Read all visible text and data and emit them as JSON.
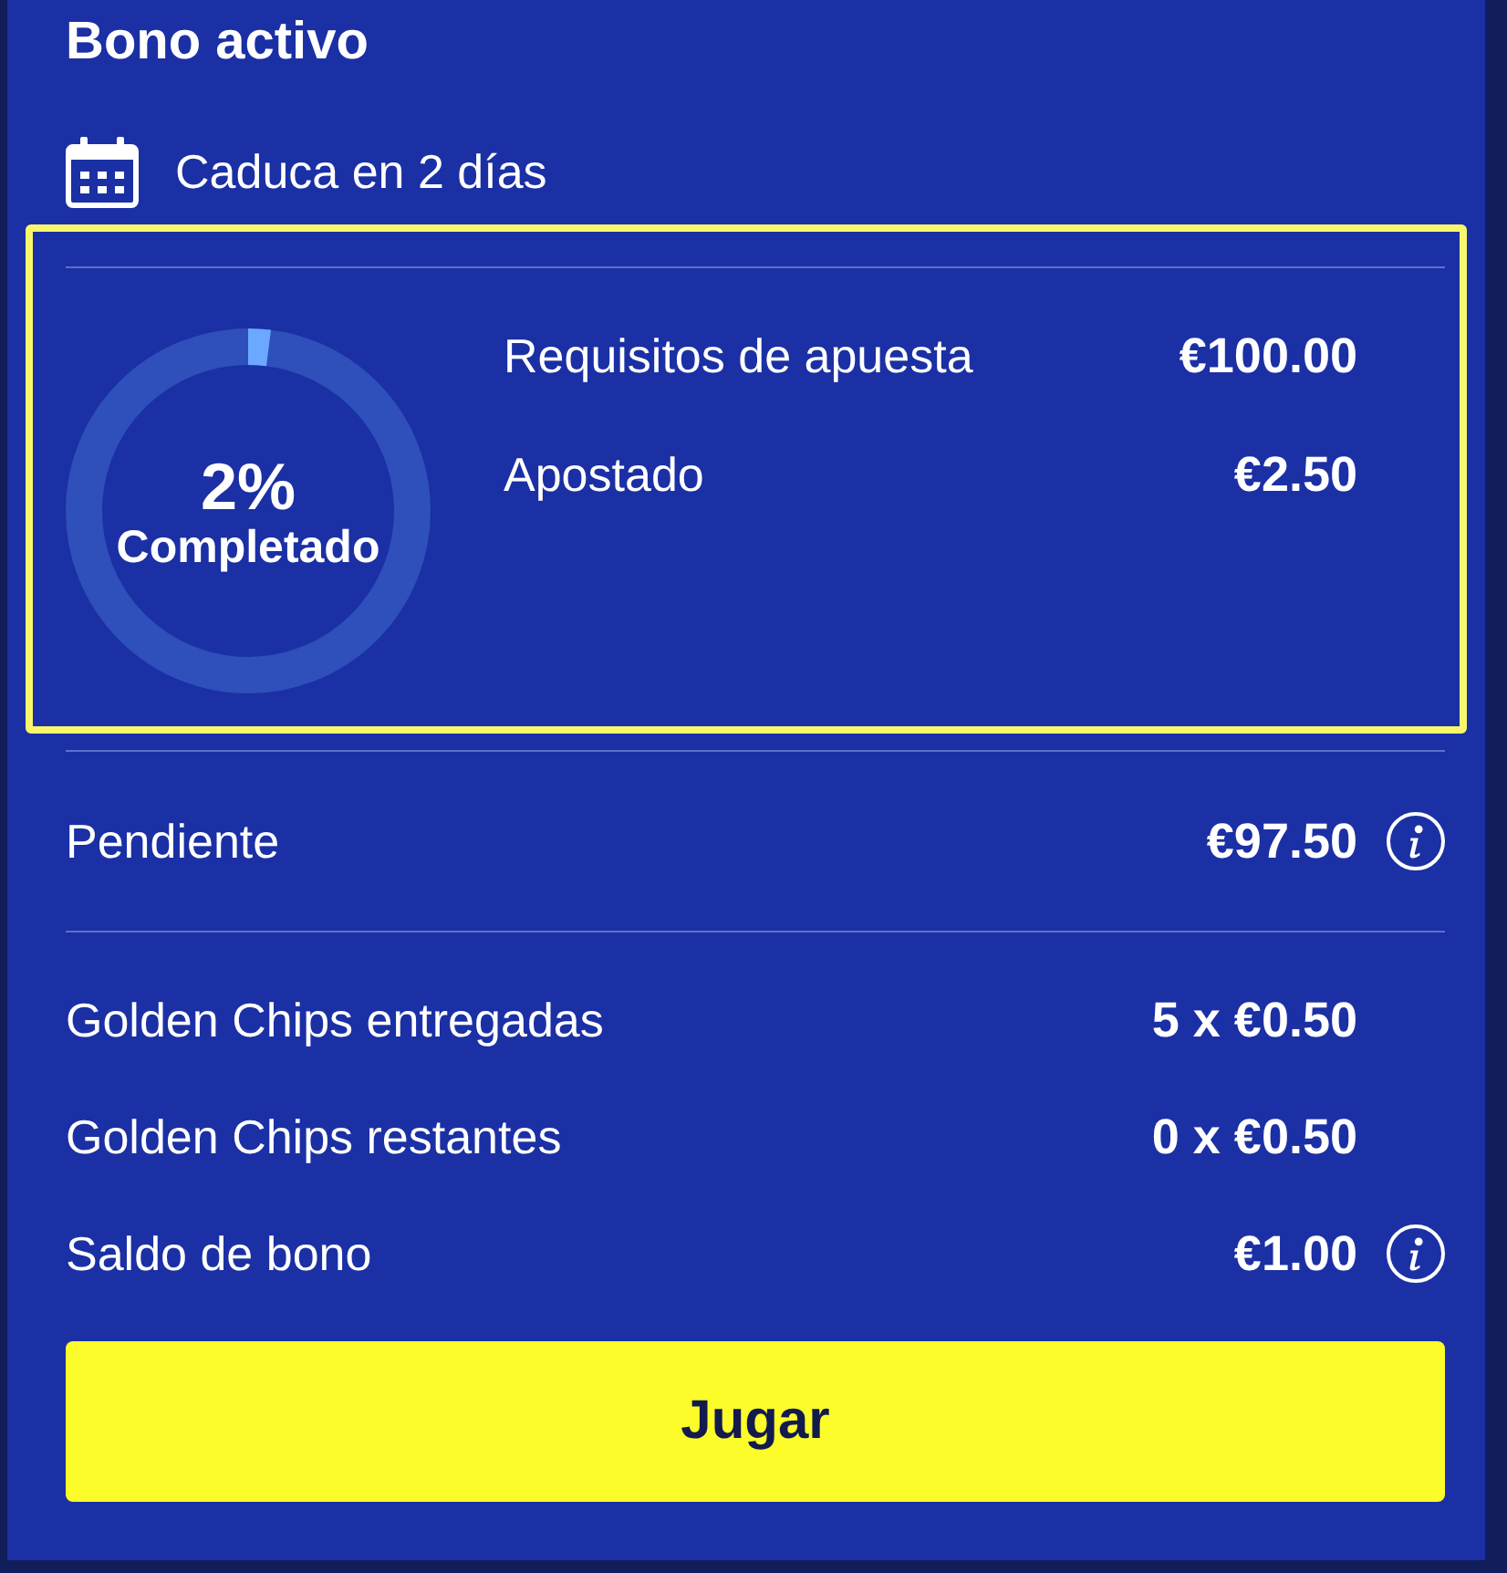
{
  "header": {
    "title": "Bono activo",
    "expiry": "Caduca en 2 días"
  },
  "progress": {
    "highlighted": true,
    "level": 0.02,
    "percent": "2%",
    "caption": "Completado",
    "rows": [
      {
        "label": "Requisitos de apuesta",
        "value": "€100.00"
      },
      {
        "label": "Apostado",
        "value": "€2.50"
      }
    ]
  },
  "pending": {
    "label": "Pendiente",
    "value": "€97.50",
    "info": true
  },
  "details": [
    {
      "label": "Golden Chips entregadas",
      "value": "5 x €0.50",
      "info": false
    },
    {
      "label": "Golden Chips restantes",
      "value": "0 x €0.50",
      "info": false
    },
    {
      "label": "Saldo de bono",
      "value": "€1.00",
      "info": true
    }
  ],
  "button": {
    "label": "Jugar"
  }
}
